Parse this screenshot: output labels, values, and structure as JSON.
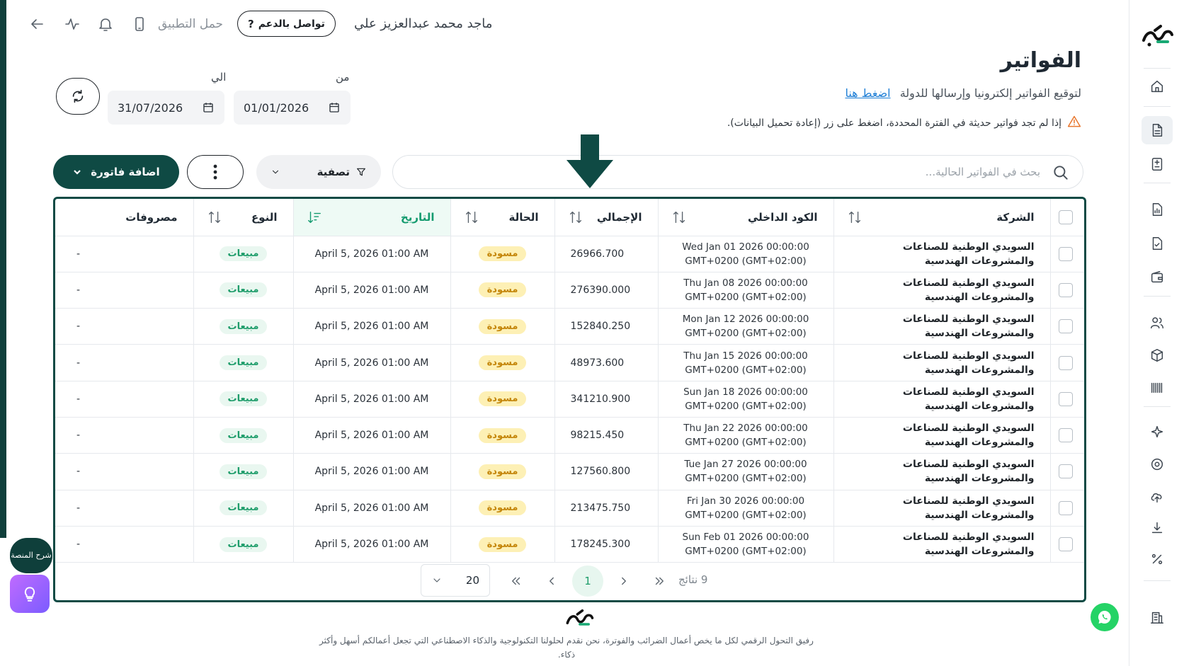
{
  "topbar": {
    "user_name": "ماجد محمد عبدالعزيز علي",
    "support_label": "تواصل بالدعم",
    "download_app": "حمل التطبيق"
  },
  "header": {
    "title": "الفواتير",
    "subtitle": "لتوقيع الفواتير إلكترونيا وإرسالها للدولة",
    "subtitle_link": "اضغط هنا",
    "warning": "إذا لم تجد فواتير حديثة في الفترة المحددة، اضغط على زر (إعادة تحميل البيانات)."
  },
  "dates": {
    "from_label": "من",
    "from_value": "01/01/2026",
    "to_label": "الي",
    "to_value": "31/07/2026"
  },
  "toolbar": {
    "add_label": "اضافة فاتورة",
    "filter_label": "تصفية",
    "search_placeholder": "بحث في الفواتير الحالية..."
  },
  "table": {
    "columns": {
      "company": "الشركة",
      "code": "الكود الداخلي",
      "total": "الإجمالي",
      "status": "الحالة",
      "date": "التاريخ",
      "type": "النوع",
      "expenses": "مصروفات"
    },
    "rows": [
      {
        "company": "السويدي الوطنية للصناعات والمشروعات الهندسية",
        "code": "Wed Jan 01 2026 00:00:00 GMT+0200 (GMT+02:00)",
        "total": "26966.700",
        "status": "مسودة",
        "date": "April 5, 2026 01:00 AM",
        "type": "مبيعات",
        "expenses": "-"
      },
      {
        "company": "السويدي الوطنية للصناعات والمشروعات الهندسية",
        "code": "Thu Jan 08 2026 00:00:00 GMT+0200 (GMT+02:00)",
        "total": "276390.000",
        "status": "مسودة",
        "date": "April 5, 2026 01:00 AM",
        "type": "مبيعات",
        "expenses": "-"
      },
      {
        "company": "السويدي الوطنية للصناعات والمشروعات الهندسية",
        "code": "Mon Jan 12 2026 00:00:00 GMT+0200 (GMT+02:00)",
        "total": "152840.250",
        "status": "مسودة",
        "date": "April 5, 2026 01:00 AM",
        "type": "مبيعات",
        "expenses": "-"
      },
      {
        "company": "السويدي الوطنية للصناعات والمشروعات الهندسية",
        "code": "Thu Jan 15 2026 00:00:00 GMT+0200 (GMT+02:00)",
        "total": "48973.600",
        "status": "مسودة",
        "date": "April 5, 2026 01:00 AM",
        "type": "مبيعات",
        "expenses": "-"
      },
      {
        "company": "السويدي الوطنية للصناعات والمشروعات الهندسية",
        "code": "Sun Jan 18 2026 00:00:00 GMT+0200 (GMT+02:00)",
        "total": "341210.900",
        "status": "مسودة",
        "date": "April 5, 2026 01:00 AM",
        "type": "مبيعات",
        "expenses": "-"
      },
      {
        "company": "السويدي الوطنية للصناعات والمشروعات الهندسية",
        "code": "Thu Jan 22 2026 00:00:00 GMT+0200 (GMT+02:00)",
        "total": "98215.450",
        "status": "مسودة",
        "date": "April 5, 2026 01:00 AM",
        "type": "مبيعات",
        "expenses": "-"
      },
      {
        "company": "السويدي الوطنية للصناعات والمشروعات الهندسية",
        "code": "Tue Jan 27 2026 00:00:00 GMT+0200 (GMT+02:00)",
        "total": "127560.800",
        "status": "مسودة",
        "date": "April 5, 2026 01:00 AM",
        "type": "مبيعات",
        "expenses": "-"
      },
      {
        "company": "السويدي الوطنية للصناعات والمشروعات الهندسية",
        "code": "Fri Jan 30 2026 00:00:00 GMT+0200 (GMT+02:00)",
        "total": "213475.750",
        "status": "مسودة",
        "date": "April 5, 2026 01:00 AM",
        "type": "مبيعات",
        "expenses": "-"
      },
      {
        "company": "السويدي الوطنية للصناعات والمشروعات الهندسية",
        "code": "Sun Feb 01 2026 00:00:00 GMT+0200 (GMT+02:00)",
        "total": "178245.300",
        "status": "مسودة",
        "date": "April 5, 2026 01:00 AM",
        "type": "مبيعات",
        "expenses": "-"
      }
    ]
  },
  "pagination": {
    "results": "9 نتائج",
    "current_page": "1",
    "page_size": "20"
  },
  "footer": {
    "text": "رفيق التحول الرقمي لكل ما يخص أعمال الضرائب والفوترة، نحن نقدم لحلولنا التكنولوجية والذكاء الاصطناعي التي تجعل أعمالكم أسهل وأكثر ذكاء."
  },
  "help": {
    "label": "شرح المنصة"
  },
  "colors": {
    "brand": "#0f4a44",
    "sorted_accent": "#149b6f",
    "draft_badge": "#fdf0b5",
    "sales_badge": "#e9f7f0"
  },
  "icons": {
    "sidebar": [
      "home-icon",
      "invoice-icon",
      "calculator-icon",
      "report-icon",
      "document-check-icon",
      "wallet-icon",
      "users-icon",
      "box-icon",
      "barcode-icon",
      "sparkle-icon",
      "settings-icon",
      "cloud-upload-icon",
      "download-icon",
      "percent-icon",
      "building-icon"
    ]
  }
}
